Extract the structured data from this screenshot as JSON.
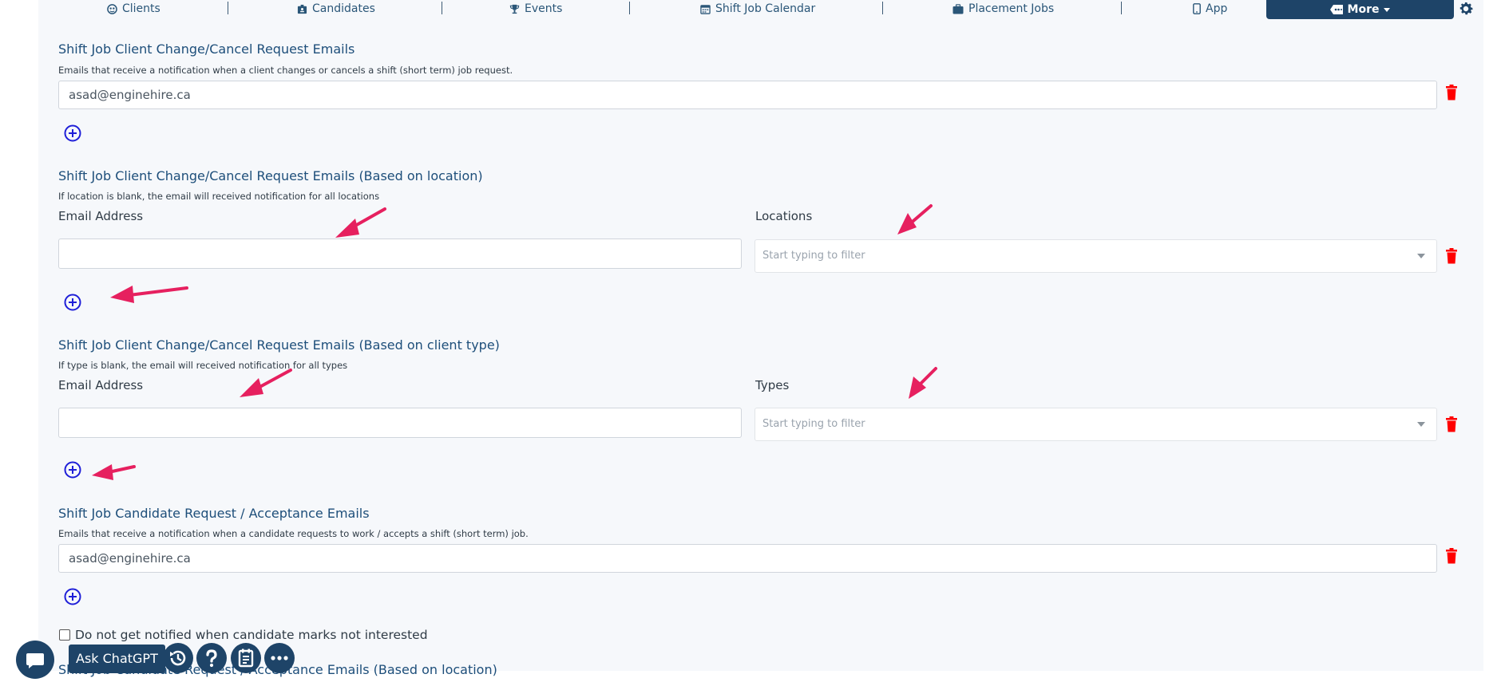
{
  "nav": {
    "items": [
      {
        "label": "Clients",
        "icon": "clients-icon"
      },
      {
        "label": "Candidates",
        "icon": "candidates-icon"
      },
      {
        "label": "Events",
        "icon": "trophy-icon"
      },
      {
        "label": "Shift Job Calendar",
        "icon": "calendar-icon"
      },
      {
        "label": "Placement Jobs",
        "icon": "briefcase-icon"
      },
      {
        "label": "App",
        "icon": "phone-icon"
      }
    ],
    "more_label": "More"
  },
  "sections": [
    {
      "title": "Shift Job Client Change/Cancel Request Emails",
      "description": "Emails that receive a notification when a client changes or cancels a shift (short term) job request.",
      "email_value": "asad@enginehire.ca"
    },
    {
      "title": "Shift Job Client Change/Cancel Request Emails (Based on location)",
      "description": "If location is blank, the email will received notification for all locations",
      "email_label": "Email Address",
      "filter_label": "Locations",
      "filter_placeholder": "Start typing to filter"
    },
    {
      "title": "Shift Job Client Change/Cancel Request Emails (Based on client type)",
      "description": "If type is blank, the email will received notification for all types",
      "email_label": "Email Address",
      "filter_label": "Types",
      "filter_placeholder": "Start typing to filter"
    },
    {
      "title": "Shift Job Candidate Request / Acceptance Emails",
      "description": "Emails that receive a notification when a candidate requests to work / accepts a shift (short term) job.",
      "email_value": "asad@enginehire.ca"
    }
  ],
  "checkbox": {
    "label": "Do not get notified when candidate marks not interested",
    "checked": false
  },
  "next_section_title_partial": "Shift Job Candidate Request / Acceptance Emails (Based on location)",
  "toolbar": {
    "ask_label": "Ask ChatGPT"
  },
  "colors": {
    "brand": "#1e4468",
    "link_blue": "#1f1fd8",
    "danger": "#ff0000",
    "arrow": "#e6205f"
  }
}
